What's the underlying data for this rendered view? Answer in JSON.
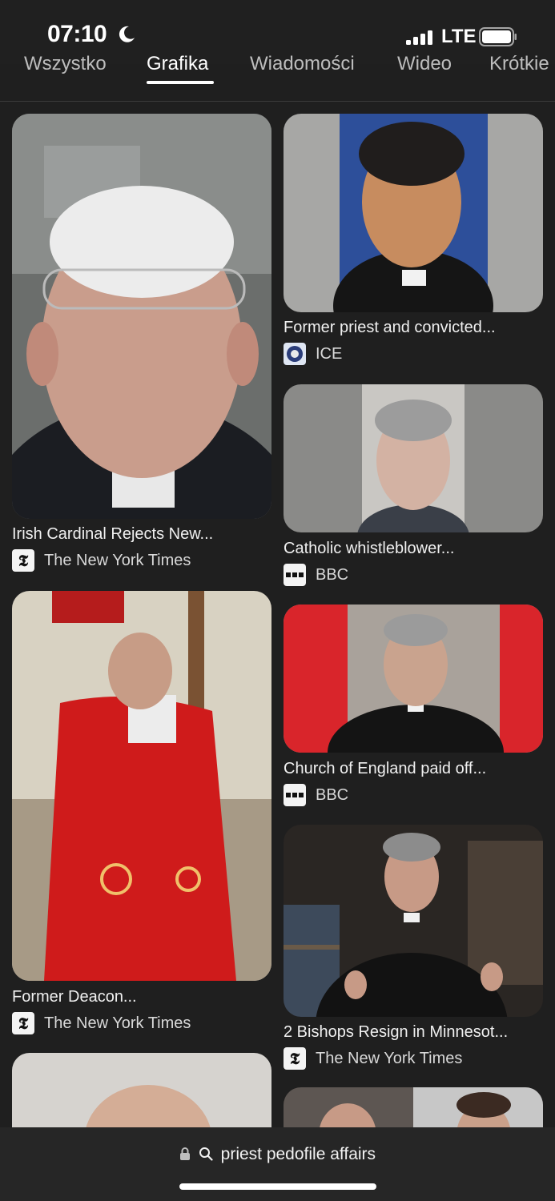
{
  "status_bar": {
    "time": "07:10",
    "network": "LTE",
    "icons": [
      "moon-icon",
      "signal-icon",
      "battery-icon"
    ]
  },
  "tabs": [
    {
      "label": "Wszystko",
      "active": false
    },
    {
      "label": "Grafika",
      "active": true
    },
    {
      "label": "Wiadomości",
      "active": false
    },
    {
      "label": "Wideo",
      "active": false
    },
    {
      "label": "Krótkie",
      "active": false
    }
  ],
  "results": [
    {
      "title": "Irish Cardinal Rejects New...",
      "source": "The New York Times",
      "source_icon": "nyt-icon"
    },
    {
      "title": "Former priest and convicted...",
      "source": "ICE",
      "source_icon": "ice-seal-icon"
    },
    {
      "title": "Catholic whistleblower...",
      "source": "BBC",
      "source_icon": "bbc-icon"
    },
    {
      "title": "Former Deacon...",
      "source": "The New York Times",
      "source_icon": "nyt-icon"
    },
    {
      "title": "Church of England paid off...",
      "source": "BBC",
      "source_icon": "bbc-icon"
    },
    {
      "title": "2 Bishops Resign in Minnesot...",
      "source": "The New York Times",
      "source_icon": "nyt-icon"
    }
  ],
  "address_bar": {
    "query": "priest pedofile affairs",
    "icons": [
      "lock-icon",
      "search-icon"
    ]
  },
  "colors": {
    "background": "#1f1f1f",
    "text": "#f0f0f0",
    "bottom_bar": "#262626"
  }
}
